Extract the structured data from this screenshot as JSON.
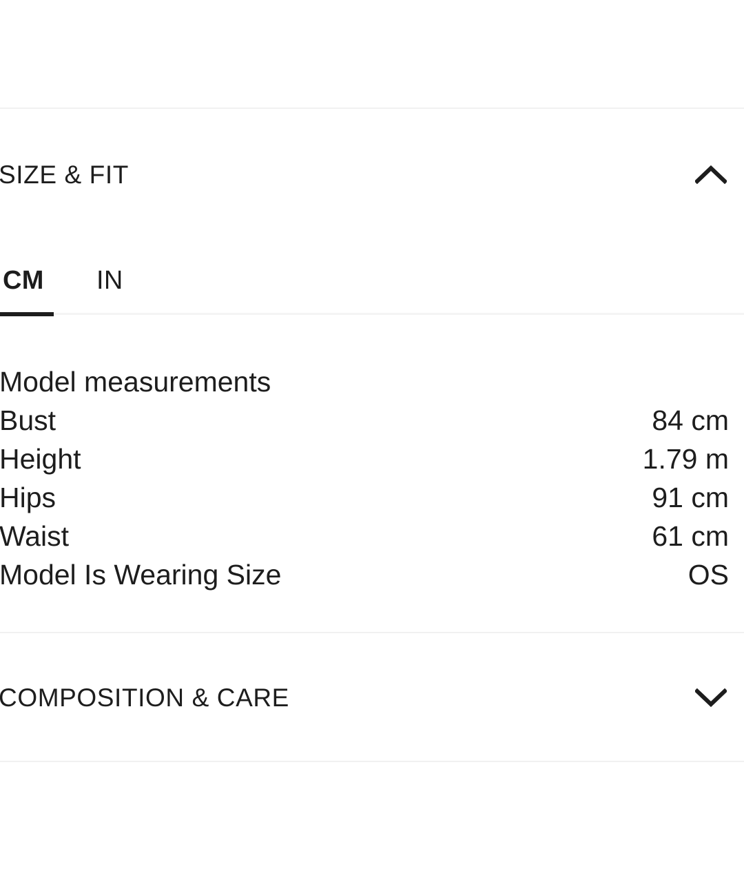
{
  "theme": {
    "background": "#ffffff",
    "text": "#1d1d1d",
    "divider": "#f1f1f1",
    "tab_underline_active": "#1d1d1d",
    "tab_underline_base": "#f4f4f4"
  },
  "sections": {
    "size_fit": {
      "title": "SIZE & FIT",
      "expanded": true,
      "chevron_icon": "chevron-up-icon"
    },
    "composition_care": {
      "title": "COMPOSITION & CARE",
      "expanded": false,
      "chevron_icon": "chevron-down-icon"
    }
  },
  "unit_tabs": {
    "selected": "CM",
    "items": [
      {
        "label": "CM",
        "active": true
      },
      {
        "label": "IN",
        "active": false
      }
    ]
  },
  "model_measurements": {
    "heading": "Model measurements",
    "rows": [
      {
        "label": "Bust",
        "value": "84 cm"
      },
      {
        "label": "Height",
        "value": "1.79 m"
      },
      {
        "label": "Hips",
        "value": "91 cm"
      },
      {
        "label": "Waist",
        "value": "61 cm"
      },
      {
        "label": "Model Is Wearing Size",
        "value": "OS"
      }
    ]
  }
}
